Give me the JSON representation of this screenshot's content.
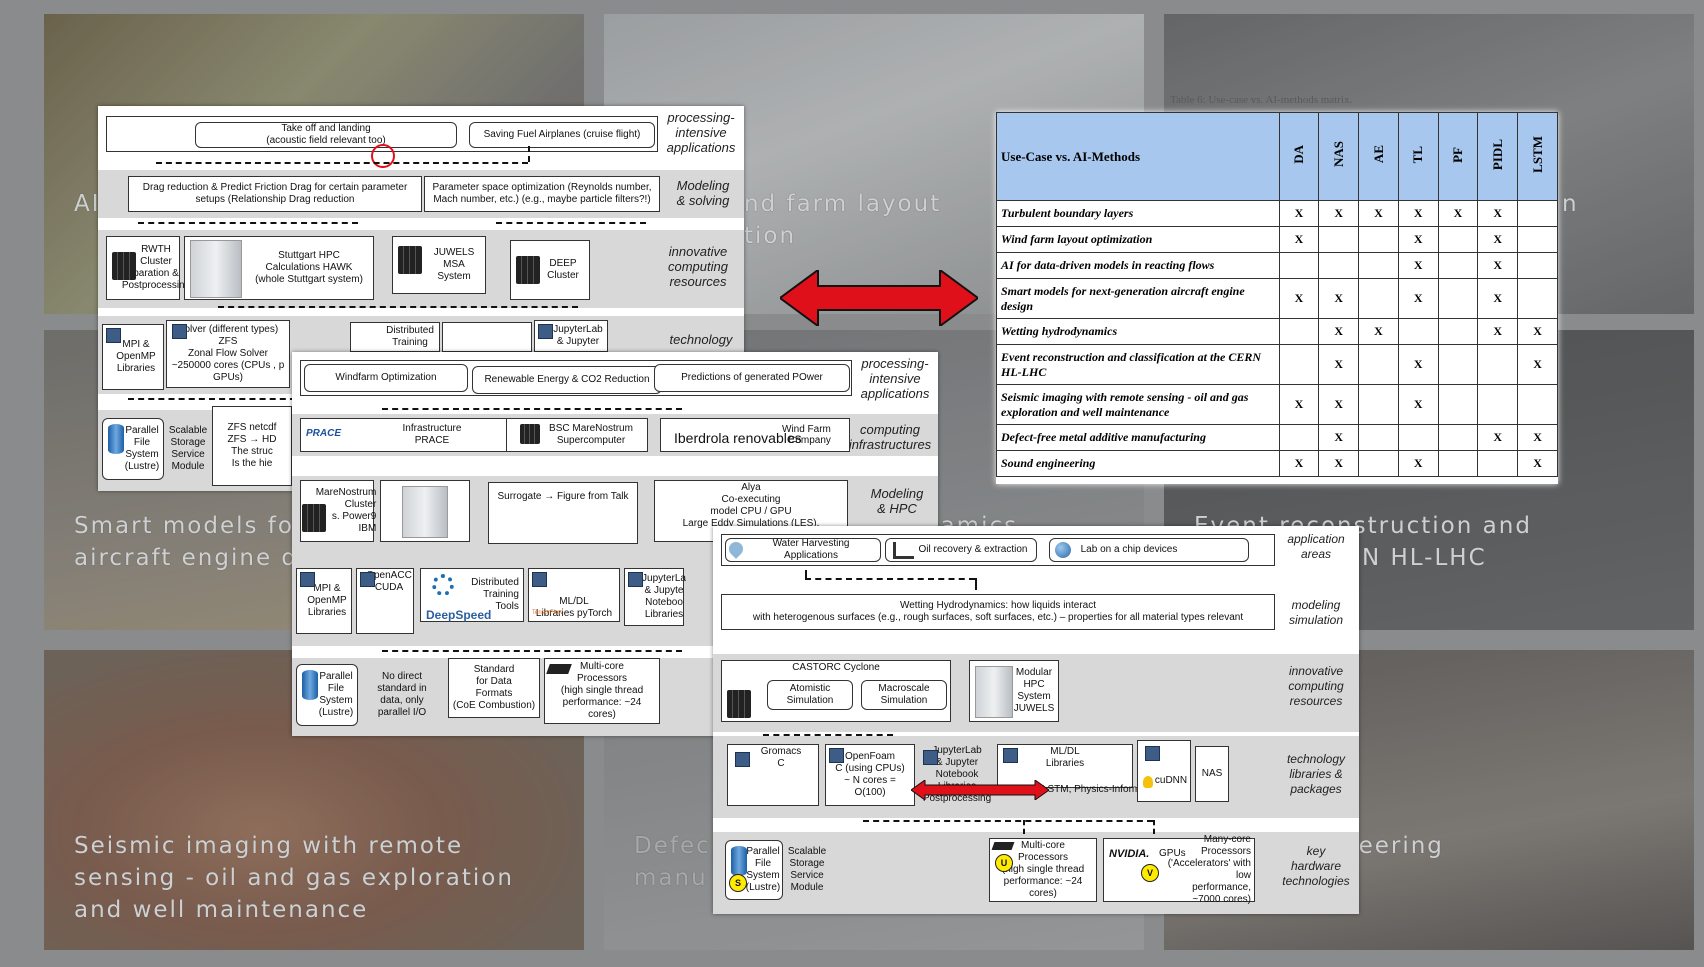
{
  "background_tiles": [
    {
      "id": "a1",
      "text": "AI",
      "color": "#7b6a3a"
    },
    {
      "id": "a2",
      "text": "nd farm layout\ntion",
      "color": "#8e9496"
    },
    {
      "id": "a3",
      "text": "n",
      "color": "#6a6a6e"
    },
    {
      "id": "b1",
      "text": "Smart models fo\naircraft engine d",
      "color": "#7b7468"
    },
    {
      "id": "b2",
      "text": "namics",
      "color": "#73777b"
    },
    {
      "id": "b3",
      "text": "Event reconstruction and\nn at the CERN HL-LHC",
      "color": "#5d6063"
    },
    {
      "id": "c1",
      "text": "Seismic imaging with remote\nsensing - oil and gas exploration\nand well maintenance",
      "color": "#8c5a3a"
    },
    {
      "id": "c2",
      "text": "Defec\nmanu",
      "color": "#7d7f82"
    },
    {
      "id": "c3",
      "text": "neering",
      "color": "#6f6a66"
    }
  ],
  "panel1": {
    "bands": [
      "processing-\nintensive\napplications",
      "Modeling\n& solving",
      "innovative\ncomputing\nresources",
      "technology"
    ],
    "top_outer": "",
    "takeoff": "Take off and landing\n(acoustic field relevant too)",
    "fuel": "Saving Fuel  Airplanes (cruise flight)",
    "drag": "Drag reduction & Predict Friction Drag for certain parameter\nsetups (Relationship Drag reduction",
    "param": "Parameter space optimization (Reynolds number,\nMach number, etc.) (e.g., maybe particle filters?!)",
    "rwth": "RWTH\nCluster\nparation &\nPostprocessing",
    "hawk": "Stuttgart  HPC\nCalculations HAWK\n(whole Stuttgart system)",
    "juwels": "JUWELS\nMSA\nSystem",
    "deep": "DEEP\nCluster",
    "mpi": "MPI &\nOpenMP\nLibraries",
    "solver": "Solver (different types)\nZFS\nZonal Flow Solver\n~250000 cores (CPUs , p\nGPUs)",
    "distributed": "Distributed\nTraining",
    "jupyter": "JupyterLab\n& Jupyter",
    "pfs": "Parallel\nFile\nSystem\n(Lustre)",
    "sssm": "Scalable\nStorage\nService\nModule",
    "zfs_netcdf": "ZFS netcdf\nZFS → HD\nThe struc\nIs the hie"
  },
  "panel2": {
    "bands": [
      "processing-\nintensive\napplications",
      "computing\ninfrastructures",
      "Modeling\n& HPC"
    ],
    "windfarm": "Windfarm Optimization",
    "renewable": "Renewable Energy & CO2 Reduction",
    "predictions": "Predictions of generated POwer",
    "prace": "Infrastructure\nPRACE",
    "prace_logo": "PRACE",
    "bsc": "BSC MareNostrum\nSupercomputer",
    "iberdrola": "Iberdrola renovables",
    "windfarm_company": "Wind Farm\nCompany",
    "marenostrum": "MareNostrum\nCluster\ns. Power9\nIBM",
    "surrogate": "Surrogate → Figure from Talk",
    "alya": "Alya\nCo-executing\nmodel CPU / GPU\nLarge Eddy Simulations (LES),",
    "mpi": "MPI &\nOpenMP\nLibraries",
    "openacc": "OpenACC\nCUDA",
    "distributed": "Distributed\nTraining\nTools",
    "deepspeed": "DeepSpeed",
    "mldl": "ML/DL\nLibraries pyTorch",
    "tensorflow": "TensorFlow",
    "jupyter": "JupyterLa\n& Jupyte\nNoteboo\nLibraries",
    "pfs": "Parallel\nFile\nSystem\n(Lustre)",
    "no_direct": "No direct\nstandard in\ndata, only\nparallel I/O",
    "standard": "Standard\nfor Data\nFormats\n(CoE Combustion)",
    "multicore": "Multi-core\nProcessors\n(high single thread\nperformance: ~24 cores)"
  },
  "panel3": {
    "bands": [
      "application\nareas",
      "modeling\nsimulation",
      "innovative\ncomputing\nresources",
      "technology\nlibraries &\npackages",
      "key\nhardware\ntechnologies"
    ],
    "water": "Water Harvesting Applications",
    "oil": "Oil recovery & extraction",
    "lab": "Lab on a chip devices",
    "wetting": "Wetting Hydrodynamics: how liquids interact\nwith heterogenous surfaces (e.g., rough surfaces, soft surfaces, etc.) – properties for all material types relevant",
    "castorc": "CASTORC Cyclone",
    "atomistic": "Atomistic\nSimulation",
    "macroscale": "Macroscale\nSimulation",
    "modular": "Modular\nHPC\nSystem\nJUWELS",
    "gromacs": "Gromacs\nC",
    "openfoam": "OpenFoam\nC (using CPUs)\n~ N cores =\nO(100)",
    "jupyter": "JupyterLab\n& Jupyter\nNotebook\nLibraries\nPostprocessing",
    "mldl": "ML/DL\nLibraries",
    "ae_lstm": "AE, LSTM, Physics-Informed DL",
    "cudnn": "cuDNN",
    "nas": "NAS",
    "pfs": "Parallel\nFile\nSystem\n(Lustre)",
    "sssm": "Scalable\nStorage\nService\nModule",
    "badge_s": "S",
    "badge_u": "U",
    "badge_v": "V",
    "multicore": "Multi-core\nProcessors\n(high single thread\nperformance: ~24 cores)",
    "nvidia": "NVIDIA.",
    "gpus": "GPUs",
    "manycore": "Many-core\nProcessors\n('Accelerators' with low\nperformance, ~7000 cores)"
  },
  "table": {
    "caption": "Table 6: Use-case vs. AI-methods matrix.",
    "header": "Use-Case vs. AI-Methods",
    "columns": [
      "DA",
      "NAS",
      "AE",
      "TL",
      "PF",
      "PIDL",
      "LSTM"
    ],
    "rows": [
      {
        "name": "Turbulent boundary layers",
        "marks": [
          "X",
          "X",
          "X",
          "X",
          "X",
          "X",
          ""
        ]
      },
      {
        "name": "Wind farm layout optimization",
        "marks": [
          "X",
          "",
          "",
          "X",
          "",
          "X",
          ""
        ]
      },
      {
        "name": "AI for data-driven models in reacting flows",
        "marks": [
          "",
          "",
          "",
          "X",
          "",
          "X",
          ""
        ]
      },
      {
        "name": "Smart models for next-generation aircraft engine design",
        "marks": [
          "X",
          "X",
          "",
          "X",
          "",
          "X",
          ""
        ]
      },
      {
        "name": "Wetting hydrodynamics",
        "marks": [
          "",
          "X",
          "X",
          "",
          "",
          "X",
          "X"
        ]
      },
      {
        "name": "Event reconstruction and classification at the CERN HL-LHC",
        "marks": [
          "",
          "X",
          "",
          "X",
          "",
          "",
          "X"
        ]
      },
      {
        "name": "Seismic imaging with remote sensing - oil and gas exploration and well maintenance",
        "marks": [
          "X",
          "X",
          "",
          "X",
          "",
          "",
          ""
        ]
      },
      {
        "name": "Defect-free metal additive manufacturing",
        "marks": [
          "",
          "X",
          "",
          "",
          "",
          "X",
          "X"
        ]
      },
      {
        "name": "Sound engineering",
        "marks": [
          "X",
          "X",
          "",
          "X",
          "",
          "",
          "X"
        ]
      }
    ]
  },
  "colors": {
    "double_arrow": "#e0101a",
    "table_header": "#a7c7ee",
    "badge": "#ffeb00"
  }
}
